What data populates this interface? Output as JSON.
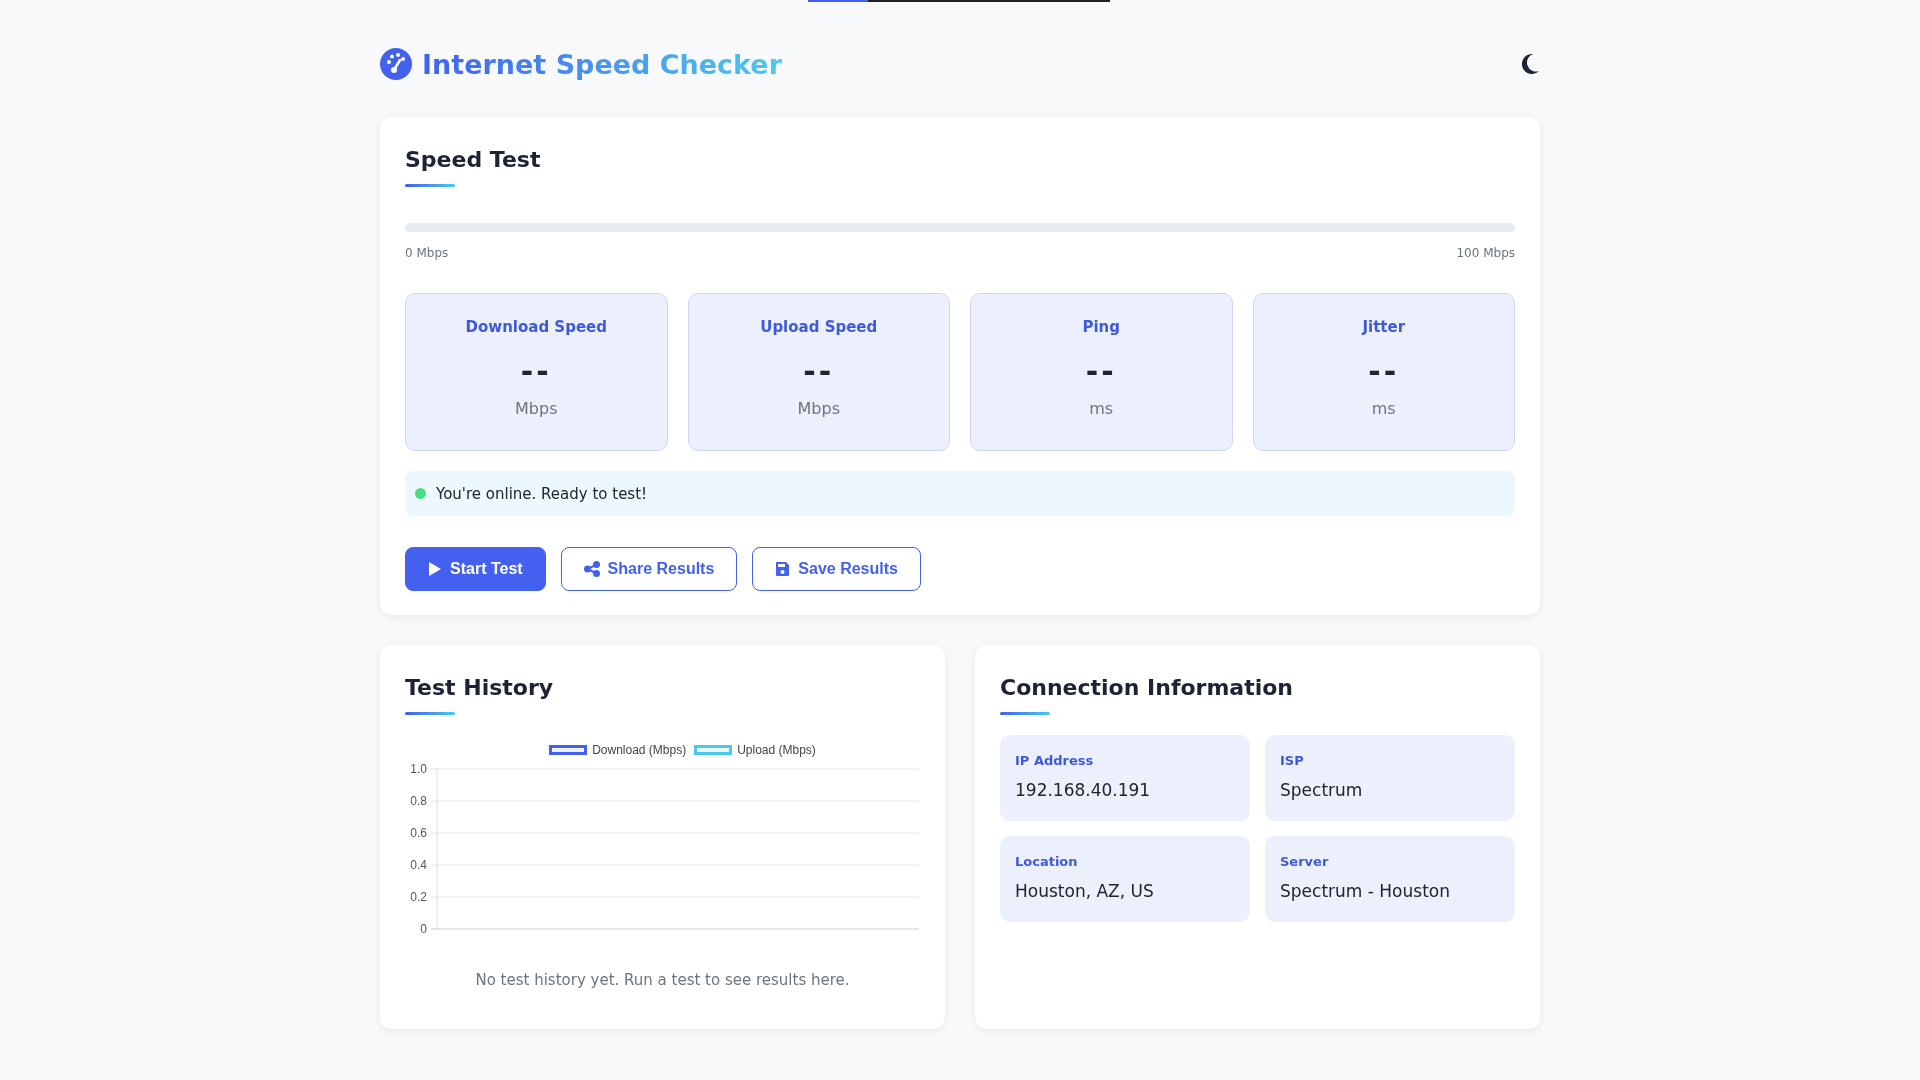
{
  "top_progress": {
    "level": 0.2
  },
  "header": {
    "title": "Internet Speed Checker"
  },
  "speed_test": {
    "title": "Speed Test",
    "meter": {
      "level": 0,
      "min_label": "0 Mbps",
      "max_label": "100 Mbps"
    },
    "metrics": [
      {
        "label": "Download Speed",
        "value": "--",
        "unit": "Mbps"
      },
      {
        "label": "Upload Speed",
        "value": "--",
        "unit": "Mbps"
      },
      {
        "label": "Ping",
        "value": "--",
        "unit": "ms"
      },
      {
        "label": "Jitter",
        "value": "--",
        "unit": "ms"
      }
    ],
    "status": {
      "online": true,
      "text": "You're online. Ready to test!"
    },
    "buttons": [
      {
        "label": "Start Test",
        "kind": "primary"
      },
      {
        "label": "Share Results",
        "kind": "outline"
      },
      {
        "label": "Save Results",
        "kind": "outline"
      }
    ]
  },
  "test_history": {
    "title": "Test History",
    "chart_data": {
      "type": "line",
      "grid": true,
      "series": [
        {
          "name": "Download (Mbps)",
          "color": "#4361ee"
        },
        {
          "name": "Upload (Mbps)",
          "color": "#4cc9f0"
        }
      ],
      "ylim": [
        0,
        1
      ],
      "yticks": [
        {
          "value": 0,
          "label": "0"
        },
        {
          "value": 0.2,
          "label": "0.2"
        },
        {
          "value": 0.4,
          "label": "0.4"
        },
        {
          "value": 0.6,
          "label": "0.6"
        },
        {
          "value": 0.8,
          "label": "0.8"
        },
        {
          "value": 1,
          "label": "1.0"
        }
      ]
    },
    "empty_message": "No test history yet. Run a test to see results here."
  },
  "connection_info": {
    "title": "Connection Information",
    "items": [
      {
        "label": "IP Address",
        "value": "192.168.40.191"
      },
      {
        "label": "ISP",
        "value": "Spectrum"
      },
      {
        "label": "Location",
        "value": "Houston, AZ, US"
      },
      {
        "label": "Server",
        "value": "Spectrum - Houston"
      }
    ]
  }
}
